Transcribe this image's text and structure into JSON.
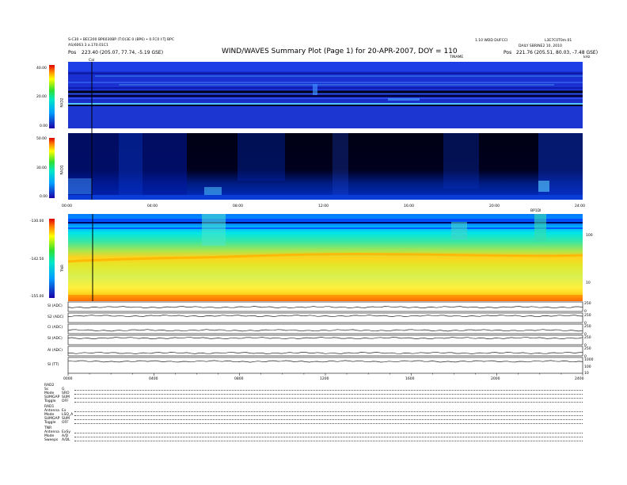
{
  "header": {
    "title": "WIND/WAVES Summary Plot (Page 1) for 20-APR-2007, DOY = 110",
    "left_line1": "S-C30 • BEC200 BP6030BP (T:O)3E 0 (BP6) • 0.FC0 I:TJ BPC",
    "left_line2": "AS)6063.3 a.170.01C1",
    "left_pos_label": "Pos",
    "left_pos_value": "223.40 (205.07, 77.74, -5.19 GSE)",
    "right_line1": "1.10 WDD DUFCCI",
    "right_line2": "DAILY SBRINE2 10, 2010",
    "right_pos_label": "Pos",
    "right_pos_value": "221.76 (205.51, 80.03, -7.48 GSE)",
    "right_code": "L3E7C0T0m.01",
    "tnr_right_label": "TINAME",
    "cal_label": "Cal",
    "khz_label": "kHz"
  },
  "panels": {
    "rad2_label": "RAD2",
    "rad1_label": "RAD1",
    "tnr_label": "TNR",
    "rad2_ticks": [
      "40.00",
      "20.00",
      "0.00"
    ],
    "rad1_ticks": [
      "50.00",
      "30.00",
      "0.00"
    ],
    "tnr_ticks": [
      "-130.00",
      "-142.50",
      "-155.00"
    ],
    "tnr_right_ticks": [
      "100",
      "10"
    ],
    "mid_time_ticks": [
      "00:00",
      "04:00",
      "08:00",
      "12:00",
      "16:00",
      "20:00",
      "24:00"
    ],
    "tnr_corner": "BP1DI"
  },
  "lines": {
    "labels": [
      "SI (ADC)",
      "S2 (ADC)",
      "CI (ADC)",
      "SI (ADC)",
      "AI (ADC)",
      "SI (TT)"
    ],
    "right_ticks": [
      [
        "250",
        "0"
      ],
      [
        "250",
        "0"
      ],
      [
        "250",
        "0"
      ],
      [
        "250",
        "0"
      ],
      [
        "250",
        "0"
      ],
      [
        "1000",
        "100",
        "10"
      ]
    ],
    "time_ticks": [
      "0000",
      "0400",
      "0800",
      "1200",
      "1600",
      "2000",
      "2400"
    ]
  },
  "info": [
    {
      "head": "RAD2",
      "rows": [
        [
          "Sc",
          "G"
        ],
        [
          "Mode",
          "SRO"
        ],
        [
          "SUMGAP",
          "SUM"
        ],
        [
          "Toggle",
          "OFF"
        ]
      ]
    },
    {
      "head": "RAD1",
      "rows": [
        [
          "Antenna",
          "Ex"
        ],
        [
          "Mode",
          "LSQ_A"
        ],
        [
          "SUMGAP",
          "SUM"
        ],
        [
          "Toggle",
          "OFF"
        ]
      ]
    },
    {
      "head": "TNR",
      "rows": [
        [
          "Antenna",
          "ExSy"
        ],
        [
          "Mode",
          "A/D"
        ],
        [
          "Sweeps",
          "A/DL"
        ]
      ]
    }
  ],
  "chart_data": [
    {
      "type": "heatmap",
      "name": "RAD2",
      "ylabel": "RAD2",
      "ylim": [
        0,
        40
      ],
      "ylabel_ticks": [
        40,
        20,
        0
      ],
      "xlim": [
        "00:00",
        "24:00"
      ],
      "colorbar": "blue-cyan-green-yellow-red"
    },
    {
      "type": "heatmap",
      "name": "RAD1",
      "ylabel": "RAD1",
      "ylim": [
        0,
        50
      ],
      "ylabel_ticks": [
        50,
        30,
        0
      ],
      "x_ticks": [
        "00:00",
        "04:00",
        "08:00",
        "12:00",
        "16:00",
        "20:00",
        "24:00"
      ],
      "colorbar": "blue-cyan-green-yellow-red"
    },
    {
      "type": "heatmap",
      "name": "TNR",
      "ylabel": "TNR",
      "colorbar_range": [
        -155,
        -130
      ],
      "colorbar_ticks": [
        -130,
        -142.5,
        -155
      ],
      "right_axis_ticks": [
        100,
        10
      ],
      "xlim": [
        "00:00",
        "24:00"
      ]
    },
    {
      "type": "line",
      "x_ticks": [
        "0000",
        "0400",
        "0800",
        "1200",
        "1600",
        "2000",
        "2400"
      ],
      "series": [
        {
          "name": "SI (ADC)",
          "level": 0.45
        },
        {
          "name": "S2 (ADC)",
          "level": 0.7
        },
        {
          "name": "CI (ADC)",
          "level": 0.35
        },
        {
          "name": "SI (ADC)",
          "level": 0.7
        },
        {
          "name": "AI (ADC)",
          "level": 0.3
        },
        {
          "name": "SI (TT)",
          "level": 0.75
        }
      ]
    }
  ]
}
